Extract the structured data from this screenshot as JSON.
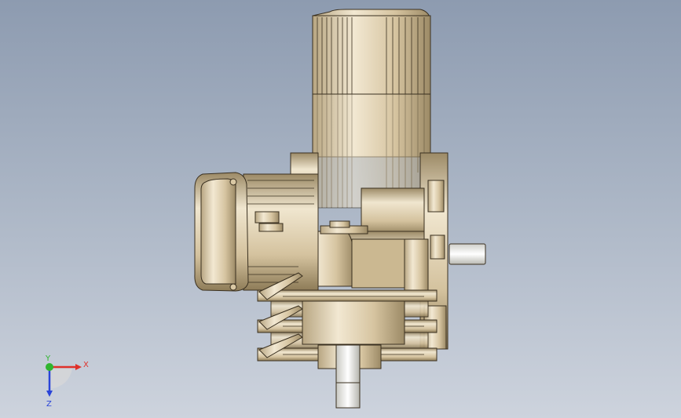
{
  "viewport": {
    "background_top": "#8d9bb0",
    "background_bottom": "#cdd3dd"
  },
  "model": {
    "name": "gear-motor-assembly",
    "body_color": "#d8c7a5",
    "edge_color": "#3a3020",
    "shaft_color": "#ecece8"
  },
  "triad": {
    "x_label": "X",
    "y_label": "Y",
    "z_label": "Z",
    "x_color": "#e0312a",
    "y_color": "#2fb52f",
    "z_color": "#2a44d8"
  }
}
